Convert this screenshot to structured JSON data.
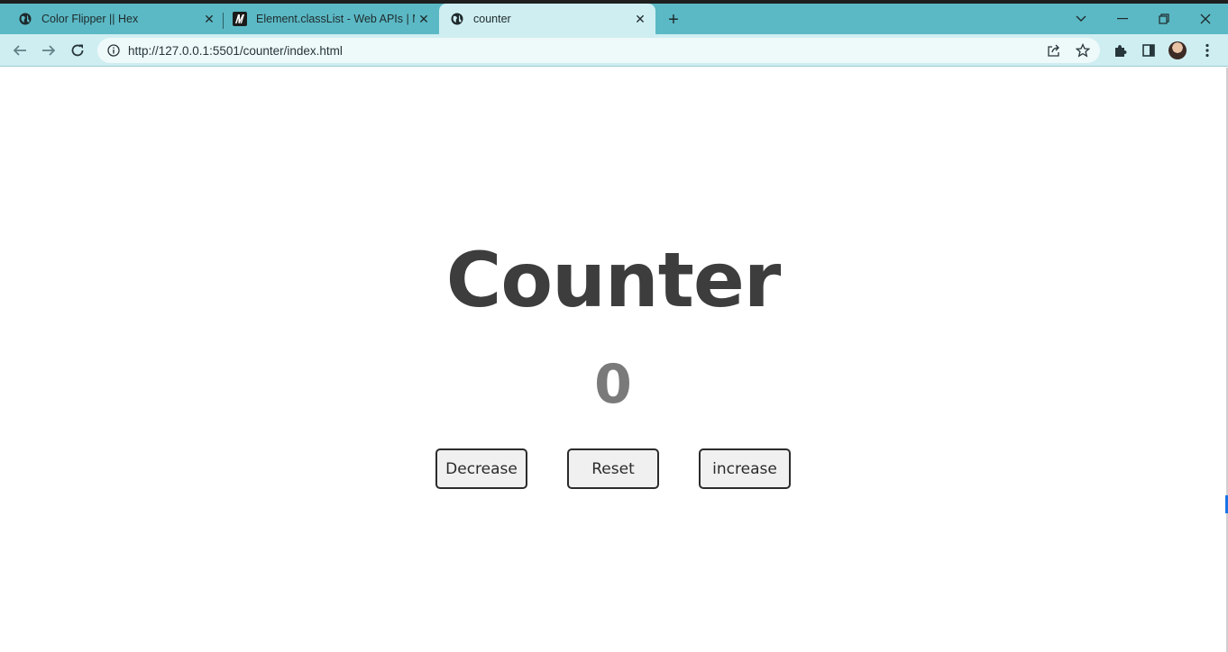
{
  "browser": {
    "tabs": [
      {
        "title": "Color Flipper || Hex",
        "icon": "globe-icon",
        "active": false
      },
      {
        "title": "Element.classList - Web APIs | MD",
        "icon": "mdn-logo-icon",
        "active": false
      },
      {
        "title": "counter",
        "icon": "globe-icon",
        "active": true
      }
    ],
    "new_tab_label": "+",
    "address": {
      "url": "http://127.0.0.1:5501/counter/index.html"
    },
    "colors": {
      "tabstrip": "#5bb9c5",
      "toolbar": "#cfeef1"
    }
  },
  "page": {
    "title": "Counter",
    "value": "0",
    "buttons": {
      "decrease": "Decrease",
      "reset": "Reset",
      "increase": "increase"
    }
  }
}
